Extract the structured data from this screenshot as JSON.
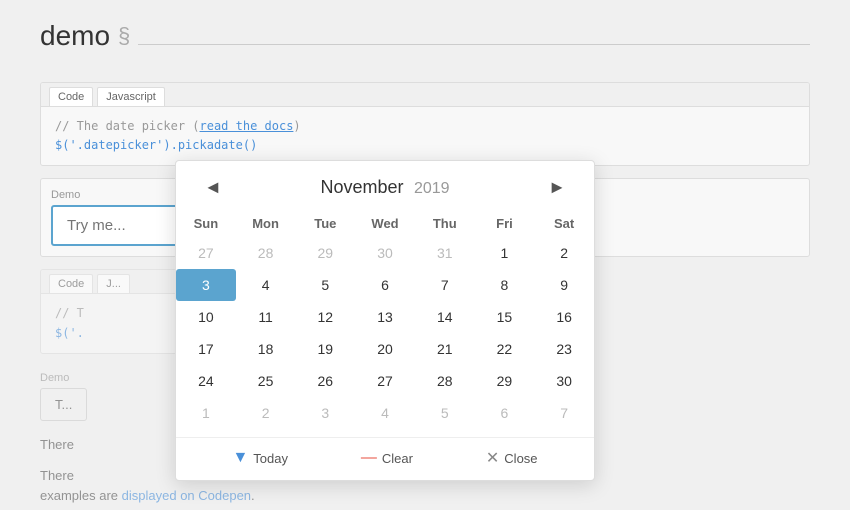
{
  "page": {
    "title": "demo",
    "section_symbol": "§"
  },
  "code_block_1": {
    "tabs": [
      "Code",
      "Javascript"
    ],
    "line1_comment": "// The date picker (",
    "line1_link_text": "read the docs",
    "line1_comment_end": ")",
    "line2": "$('.datepicker').pickadate()"
  },
  "demo": {
    "label": "Demo",
    "input_placeholder": "Try me..."
  },
  "code_block_2": {
    "tabs": [
      "Code",
      "J..."
    ],
    "line1": "// T",
    "line2": "$('."
  },
  "demo2": {
    "button_label": "T..."
  },
  "text1": {
    "content": "There                                                                                      uch as m..."
  },
  "text2": {
    "prefix": "There",
    "link_text": "displayed on Codepen",
    "suffix": "examples are",
    "period": "."
  },
  "calendar": {
    "prev_arrow": "◄",
    "next_arrow": "►",
    "month": "November",
    "year": "2019",
    "weekdays": [
      "Sun",
      "Mon",
      "Tue",
      "Wed",
      "Thu",
      "Fri",
      "Sat"
    ],
    "weeks": [
      [
        {
          "day": "27",
          "other": true
        },
        {
          "day": "28",
          "other": true
        },
        {
          "day": "29",
          "other": true
        },
        {
          "day": "30",
          "other": true
        },
        {
          "day": "31",
          "other": true
        },
        {
          "day": "1",
          "other": false
        },
        {
          "day": "2",
          "other": false
        }
      ],
      [
        {
          "day": "3",
          "other": false,
          "selected": true
        },
        {
          "day": "4",
          "other": false
        },
        {
          "day": "5",
          "other": false
        },
        {
          "day": "6",
          "other": false
        },
        {
          "day": "7",
          "other": false
        },
        {
          "day": "8",
          "other": false
        },
        {
          "day": "9",
          "other": false
        }
      ],
      [
        {
          "day": "10",
          "other": false
        },
        {
          "day": "11",
          "other": false
        },
        {
          "day": "12",
          "other": false
        },
        {
          "day": "13",
          "other": false
        },
        {
          "day": "14",
          "other": false
        },
        {
          "day": "15",
          "other": false
        },
        {
          "day": "16",
          "other": false
        }
      ],
      [
        {
          "day": "17",
          "other": false
        },
        {
          "day": "18",
          "other": false
        },
        {
          "day": "19",
          "other": false
        },
        {
          "day": "20",
          "other": false
        },
        {
          "day": "21",
          "other": false
        },
        {
          "day": "22",
          "other": false
        },
        {
          "day": "23",
          "other": false
        }
      ],
      [
        {
          "day": "24",
          "other": false
        },
        {
          "day": "25",
          "other": false
        },
        {
          "day": "26",
          "other": false
        },
        {
          "day": "27",
          "other": false
        },
        {
          "day": "28",
          "other": false
        },
        {
          "day": "29",
          "other": false
        },
        {
          "day": "30",
          "other": false
        }
      ],
      [
        {
          "day": "1",
          "other": true
        },
        {
          "day": "2",
          "other": true
        },
        {
          "day": "3",
          "other": true
        },
        {
          "day": "4",
          "other": true
        },
        {
          "day": "5",
          "other": true
        },
        {
          "day": "6",
          "other": true
        },
        {
          "day": "7",
          "other": true
        }
      ]
    ],
    "footer": {
      "today_label": "Today",
      "clear_label": "Clear",
      "close_label": "Close"
    }
  }
}
